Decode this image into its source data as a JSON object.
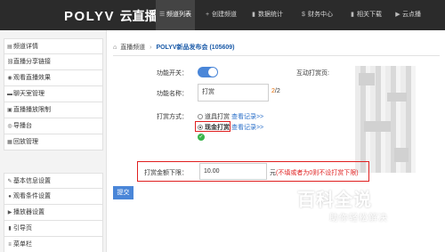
{
  "brand": {
    "logo": "POLYV",
    "logo_cn": "云直播"
  },
  "nav": [
    {
      "label": "频道列表",
      "icon": "list-icon",
      "active": true
    },
    {
      "label": "创建频道",
      "icon": "plus-icon"
    },
    {
      "label": "数据统计",
      "icon": "bar-chart-icon"
    },
    {
      "label": "财务中心",
      "icon": "dollar-icon"
    },
    {
      "label": "相关下载",
      "icon": "download-icon"
    },
    {
      "label": "云点播",
      "icon": "play-icon"
    }
  ],
  "sidebar": {
    "groups": [
      {
        "items": [
          {
            "label": "频道详情",
            "icon": "folder-icon"
          },
          {
            "label": "直播分享链接",
            "icon": "link-icon"
          },
          {
            "label": "观看直播效果",
            "icon": "eye-icon"
          },
          {
            "label": "聊天室管理",
            "icon": "chat-icon"
          },
          {
            "label": "直播播放限制",
            "icon": "lock-icon"
          },
          {
            "label": "导播台",
            "icon": "compass-icon"
          },
          {
            "label": "回放管理",
            "icon": "replay-icon"
          }
        ]
      },
      {
        "items": [
          {
            "label": "基本信息设置",
            "icon": "edit-icon"
          },
          {
            "label": "观看条件设置",
            "icon": "user-icon"
          },
          {
            "label": "播放器设置",
            "icon": "player-icon"
          },
          {
            "label": "引导页",
            "icon": "guide-icon"
          },
          {
            "label": "菜单栏",
            "icon": "menu-icon"
          }
        ]
      }
    ]
  },
  "breadcrumb": {
    "section": "直播频道",
    "title": "POLYV新品发布会 (105609)"
  },
  "form": {
    "switch_label": "功能开关：",
    "switch_on": true,
    "name_label": "功能名称：",
    "name_value": "打赏",
    "name_count": "2",
    "name_max": "/2",
    "method_label": "打赏方式：",
    "options": [
      {
        "label": "道具打赏",
        "link": "查看记录>>",
        "selected": false
      },
      {
        "label": "现金打赏",
        "link": "查看记录>>",
        "selected": true
      }
    ],
    "min_label": "打赏金额下限：",
    "min_value": "10.00",
    "min_unit": "元",
    "min_note": "(不填或者为0则不设打赏下限)",
    "submit_label": "提交"
  },
  "preview": {
    "label": "互动打赏页:"
  },
  "watermark": {
    "big": "百科全说",
    "small": "助你轻松解决"
  },
  "colors": {
    "accent": "#4a86d8",
    "highlight": "#e02020",
    "topbar": "#2b2b2b",
    "success": "#39b54a"
  }
}
